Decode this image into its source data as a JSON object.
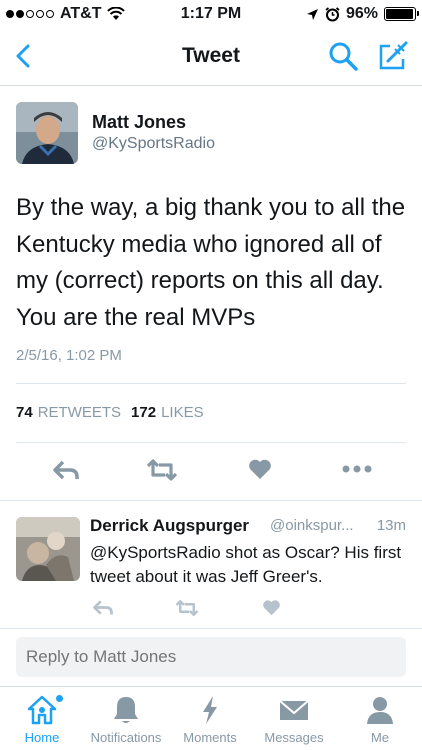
{
  "status_bar": {
    "carrier": "AT&T",
    "time": "1:17 PM",
    "battery": "96%",
    "battery_level": 0.96
  },
  "nav": {
    "title": "Tweet"
  },
  "tweet": {
    "author_name": "Matt Jones",
    "author_handle": "@KySportsRadio",
    "text": "By the way, a big thank you to all the Kentucky media who ignored all of my (correct) reports on this all day. You are the real MVPs",
    "timestamp": "2/5/16, 1:02 PM",
    "retweets_count": "74",
    "retweets_label": "RETWEETS",
    "likes_count": "172",
    "likes_label": "LIKES"
  },
  "reply_tweet": {
    "author_name": "Derrick Augspurger",
    "author_handle": "@oinkspur...",
    "time": "13m",
    "text": "@KySportsRadio shot as Oscar? His first tweet about it was Jeff Greer's."
  },
  "composer": {
    "placeholder": "Reply to Matt Jones"
  },
  "tabs": [
    {
      "label": "Home",
      "icon": "home-icon",
      "active": true
    },
    {
      "label": "Notifications",
      "icon": "bell-icon",
      "active": false
    },
    {
      "label": "Moments",
      "icon": "lightning-icon",
      "active": false
    },
    {
      "label": "Messages",
      "icon": "envelope-icon",
      "active": false
    },
    {
      "label": "Me",
      "icon": "person-icon",
      "active": false
    }
  ],
  "colors": {
    "accent": "#1da1f2",
    "secondary_text": "#8899a6",
    "icon_gray": "#8899a6"
  }
}
